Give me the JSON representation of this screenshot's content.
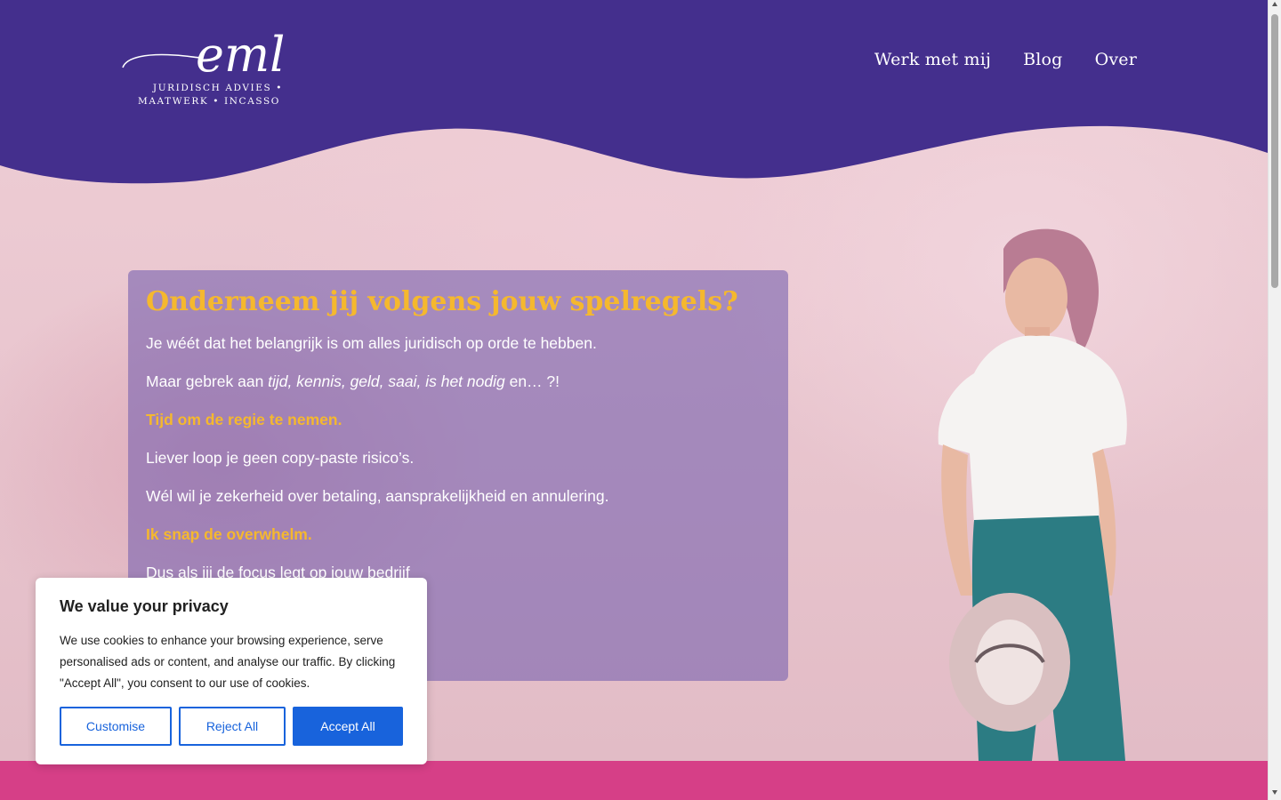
{
  "brand": {
    "logo_script": "eml",
    "tagline_line1": "JURIDISCH ADVIES •",
    "tagline_line2": "MAATWERK • INCASSO"
  },
  "nav": {
    "items": [
      {
        "label": "Werk met mij"
      },
      {
        "label": "Blog"
      },
      {
        "label": "Over"
      }
    ]
  },
  "hero": {
    "title": "Onderneem jij volgens jouw spelregels?",
    "p1": "Je wéét dat het belangrijk is om alles juridisch op orde te hebben.",
    "p2_before": "Maar gebrek aan ",
    "p2_italic": "tijd, kennis, geld, saai, is het nodig",
    "p2_after": " en… ?!",
    "accent1": "Tijd om de regie te nemen.",
    "p3": "Liever loop je geen copy-paste risico’s.",
    "p4": "Wél wil je zekerheid over betaling, aansprakelijkheid en annulering.",
    "accent2": "Ik snap de overwhelm.",
    "p5": "Dus als jij de focus legt op jouw bedrijf"
  },
  "cookie": {
    "title": "We value your privacy",
    "description": "We use cookies to enhance your browsing experience, serve personalised ads or content, and analyse our traffic. By clicking \"Accept All\", you consent to our use of cookies.",
    "customise_label": "Customise",
    "reject_label": "Reject All",
    "accept_label": "Accept All"
  },
  "colors": {
    "header_purple": "#442f8d",
    "accent_yellow": "#f5b82e",
    "footer_pink": "#d63f87",
    "cookie_blue": "#1863dc"
  },
  "icons": {
    "scroll_up": "chevron-up-icon",
    "scroll_down": "chevron-down-icon"
  }
}
